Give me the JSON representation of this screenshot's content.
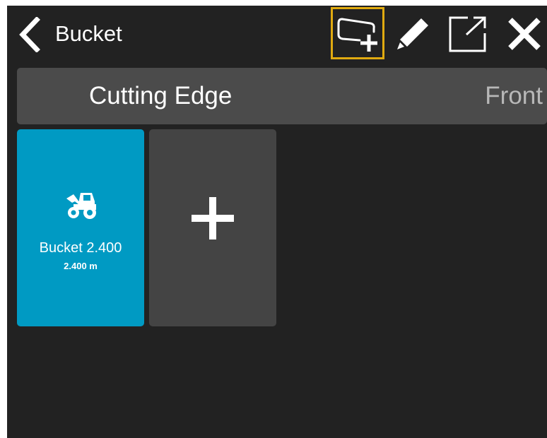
{
  "header": {
    "title": "Bucket",
    "icons": {
      "back": "chevron-left-icon",
      "add_shape": "add-shape-icon",
      "edit": "pencil-icon",
      "export": "external-link-icon",
      "close": "close-icon"
    },
    "highlight_color": "#e0aa10"
  },
  "edge_bar": {
    "title": "Cutting Edge",
    "side": "Front"
  },
  "buckets": [
    {
      "name": "Bucket 2.400",
      "width": "2.400 m",
      "icon": "wheel-loader-icon",
      "color": "#009ac3"
    }
  ],
  "add_tile": {
    "icon": "plus-icon"
  },
  "colors": {
    "background": "#222222",
    "bar": "#4b4b4b",
    "tile_add": "#444444",
    "accent": "#009ac3"
  }
}
